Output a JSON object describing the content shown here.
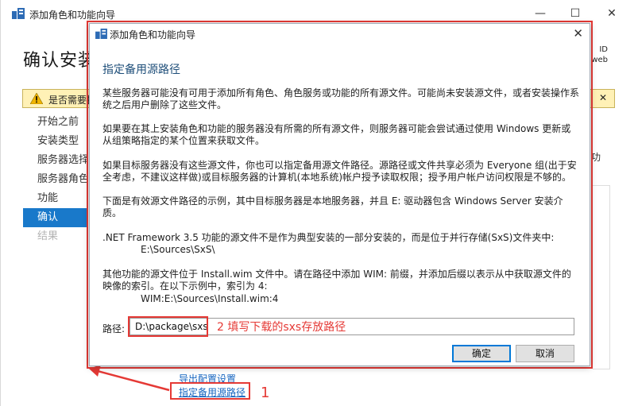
{
  "background": {
    "window_title": "添加角色和功能向导",
    "heading": "确认安装",
    "right_top_text": "ID\nweb",
    "warning_text": "是否需要指定备用源路径？一个或多个安装选择缺少源文件",
    "nav_items": [
      {
        "label": "开始之前",
        "state": "normal"
      },
      {
        "label": "安装类型",
        "state": "normal"
      },
      {
        "label": "服务器选择",
        "state": "normal"
      },
      {
        "label": "服务器角色",
        "state": "normal"
      },
      {
        "label": "功能",
        "state": "normal"
      },
      {
        "label": "确认",
        "state": "active"
      },
      {
        "label": "结果",
        "state": "disabled"
      }
    ],
    "right_side_text": "功",
    "export_link": "导出配置设置",
    "alt_source_link": "指定备用源路径",
    "step1_label": "1"
  },
  "dialog": {
    "title": "添加角色和功能向导",
    "heading": "指定备用源路径",
    "paragraphs": [
      "某些服务器可能没有可用于添加所有角色、角色服务或功能的所有源文件。可能尚未安装源文件，或者安装操作系统之后用户删除了这些文件。",
      "如果要在其上安装角色和功能的服务器没有所需的所有源文件，则服务器可能会尝试通过使用 Windows 更新或从组策略指定的某个位置来获取文件。",
      "如果目标服务器没有这些源文件，你也可以指定备用源文件路径。源路径或文件共享必须为 Everyone 组(出于安全考虑，不建议这样做)或目标服务器的计算机(本地系统)帐户授予读取权限；授予用户帐户访问权限是不够的。",
      "下面是有效源文件路径的示例，其中目标服务器是本地服务器，并且 E: 驱动器包含 Windows Server 安装介质。"
    ],
    "netfx_text": ".NET Framework 3.5 功能的源文件不是作为典型安装的一部分安装的，而是位于并行存储(SxS)文件夹中:",
    "netfx_example": "E:\\Sources\\SxS\\",
    "wim_text": "其他功能的源文件位于 Install.wim 文件中。请在路径中添加 WIM: 前缀，并添加后缀以表示从中获取源文件的映像的索引。在以下示例中，索引为 4:",
    "wim_example": "WIM:E:\\Sources\\Install.wim:4",
    "path_label": "路径:",
    "path_value": "D:\\package\\sxs",
    "step2_label": "2 填写下载的sxs存放路径",
    "ok_label": "确定",
    "cancel_label": "取消"
  },
  "colors": {
    "annotation_red": "#e53935",
    "heading_blue": "#1e4e79",
    "nav_active": "#1979ca",
    "link_blue": "#1565c0",
    "warning_bg": "#fff1b6"
  }
}
